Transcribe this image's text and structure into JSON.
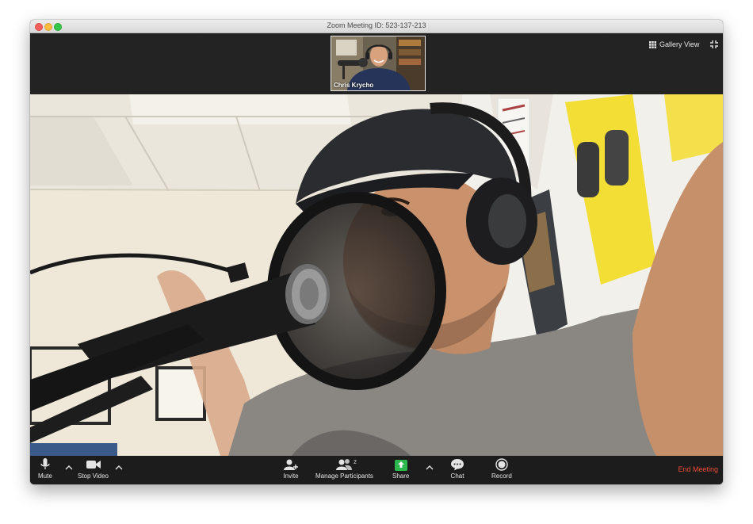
{
  "window": {
    "title": "Zoom Meeting ID: 523-137-213"
  },
  "top_bar": {
    "thumbnail_name": "Chris Krycho",
    "gallery_view_label": "Gallery View"
  },
  "toolbar": {
    "mute_label": "Mute",
    "stop_video_label": "Stop Video",
    "invite_label": "Invite",
    "manage_participants_label": "Manage Participants",
    "participant_count": "2",
    "share_label": "Share",
    "chat_label": "Chat",
    "record_label": "Record",
    "end_meeting_label": "End Meeting"
  },
  "colors": {
    "share_green": "#2db84d",
    "end_meeting_red": "#ec4c36",
    "toolbar_bg": "#1c1c1c"
  }
}
